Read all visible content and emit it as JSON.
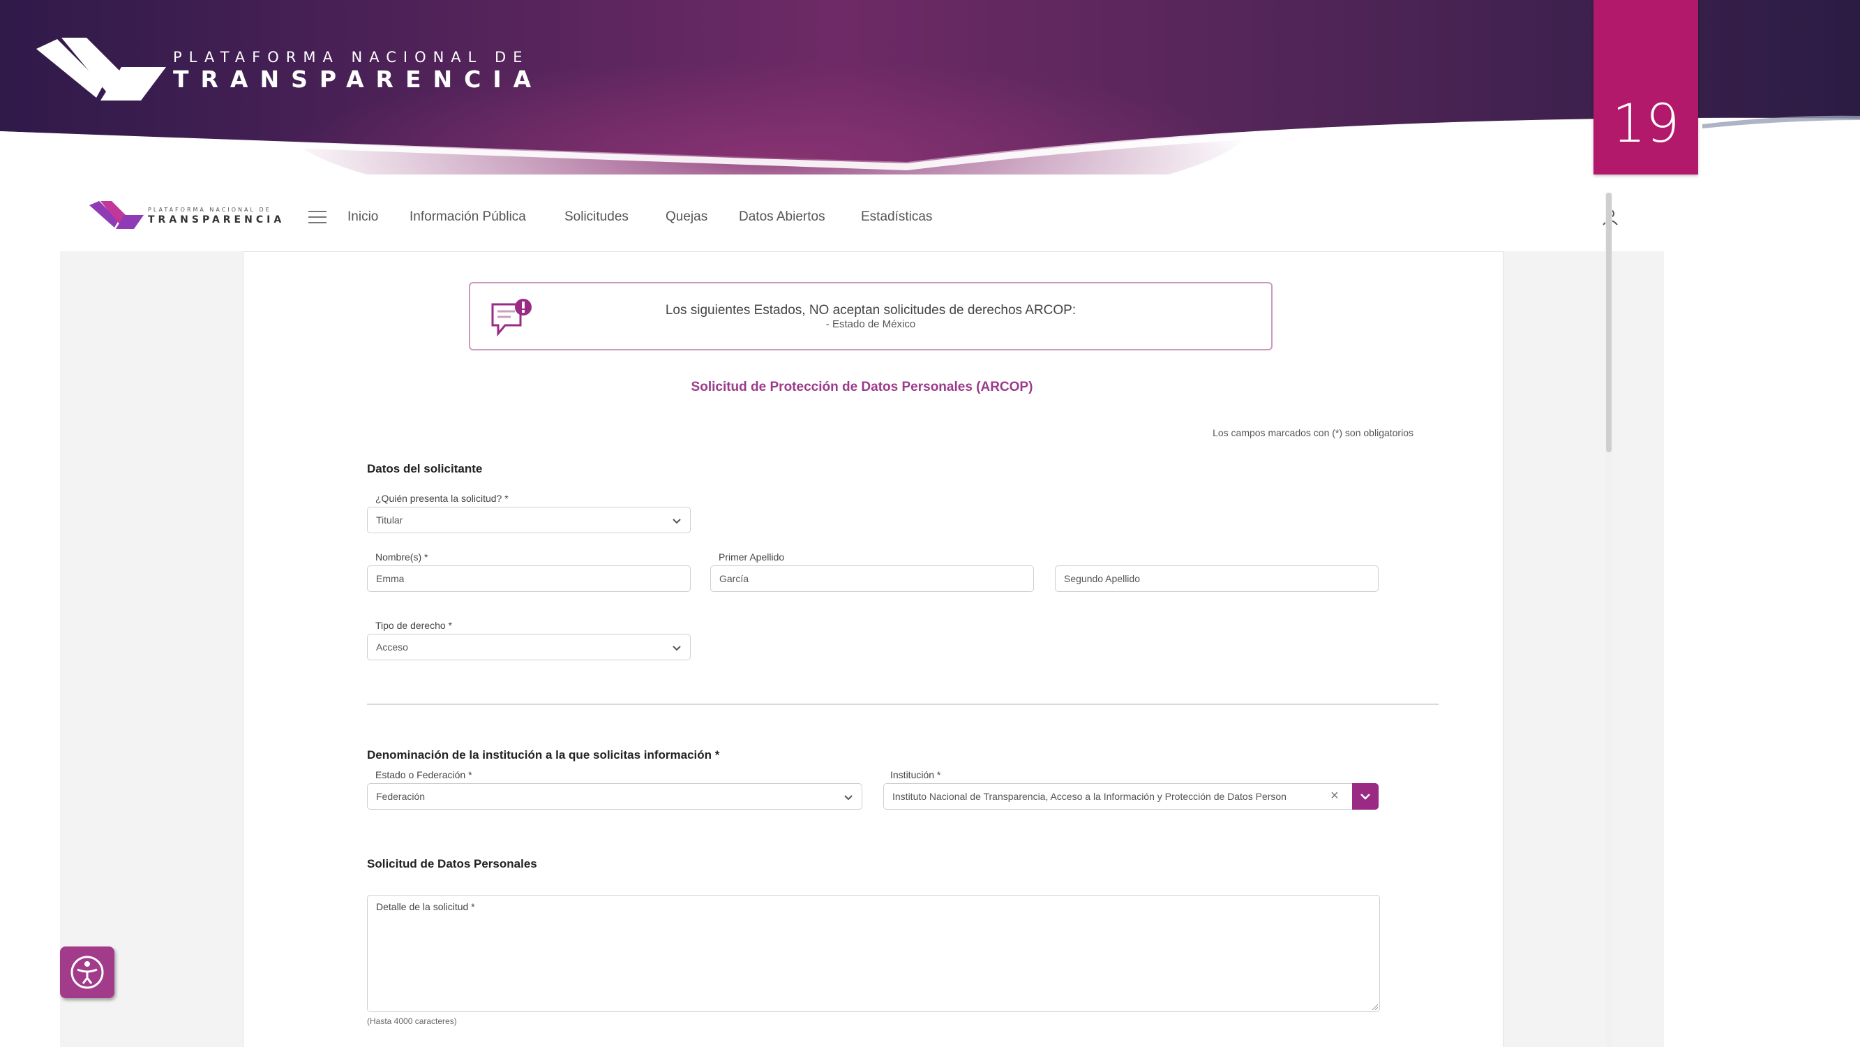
{
  "slide": {
    "brand_line1": "PLATAFORMA NACIONAL DE",
    "brand_line2": "TRANSPARENCIA",
    "page_number": "19",
    "colors": {
      "banner_dark": "#2e1d4a",
      "banner_mid": "#7a2d6b",
      "number_box": "#b3196b"
    }
  },
  "app": {
    "logo_line1": "PLATAFORMA NACIONAL DE",
    "logo_line2": "TRANSPARENCIA",
    "nav": [
      "Inicio",
      "Información Pública",
      "Solicitudes",
      "Quejas",
      "Datos Abiertos",
      "Estadísticas"
    ],
    "icons": {
      "menu": "hamburger-icon",
      "user": "user-icon",
      "accessibility": "accessibility-icon"
    }
  },
  "alert": {
    "line1": "Los siguientes Estados, NO aceptan solicitudes de derechos ARCOP:",
    "line2": "- Estado de México"
  },
  "form": {
    "title": "Solicitud de Protección de Datos Personales (ARCOP)",
    "required_note": "Los campos marcados con (*) son obligatorios",
    "applicant": {
      "section": "Datos del solicitante",
      "who_label": "¿Quién presenta la solicitud? *",
      "who_value": "Titular",
      "name_label": "Nombre(s) *",
      "name_value": "Emma",
      "surname1_label": "Primer Apellido",
      "surname1_value": "García",
      "surname2_value": "Segundo Apellido",
      "right_type_label": "Tipo de derecho *",
      "right_type_value": "Acceso"
    },
    "institution": {
      "section": "Denominación de la institución a la que solicitas información *",
      "state_label": "Estado o Federación *",
      "state_value": "Federación",
      "inst_label": "Institución *",
      "inst_value": "Instituto Nacional de Transparencia, Acceso a la Información y Protección de Datos Person"
    },
    "request": {
      "section": "Solicitud de Datos Personales",
      "detail_label": "Detalle de la solicitud *",
      "char_hint": "(Hasta 4000 caracteres)"
    }
  }
}
